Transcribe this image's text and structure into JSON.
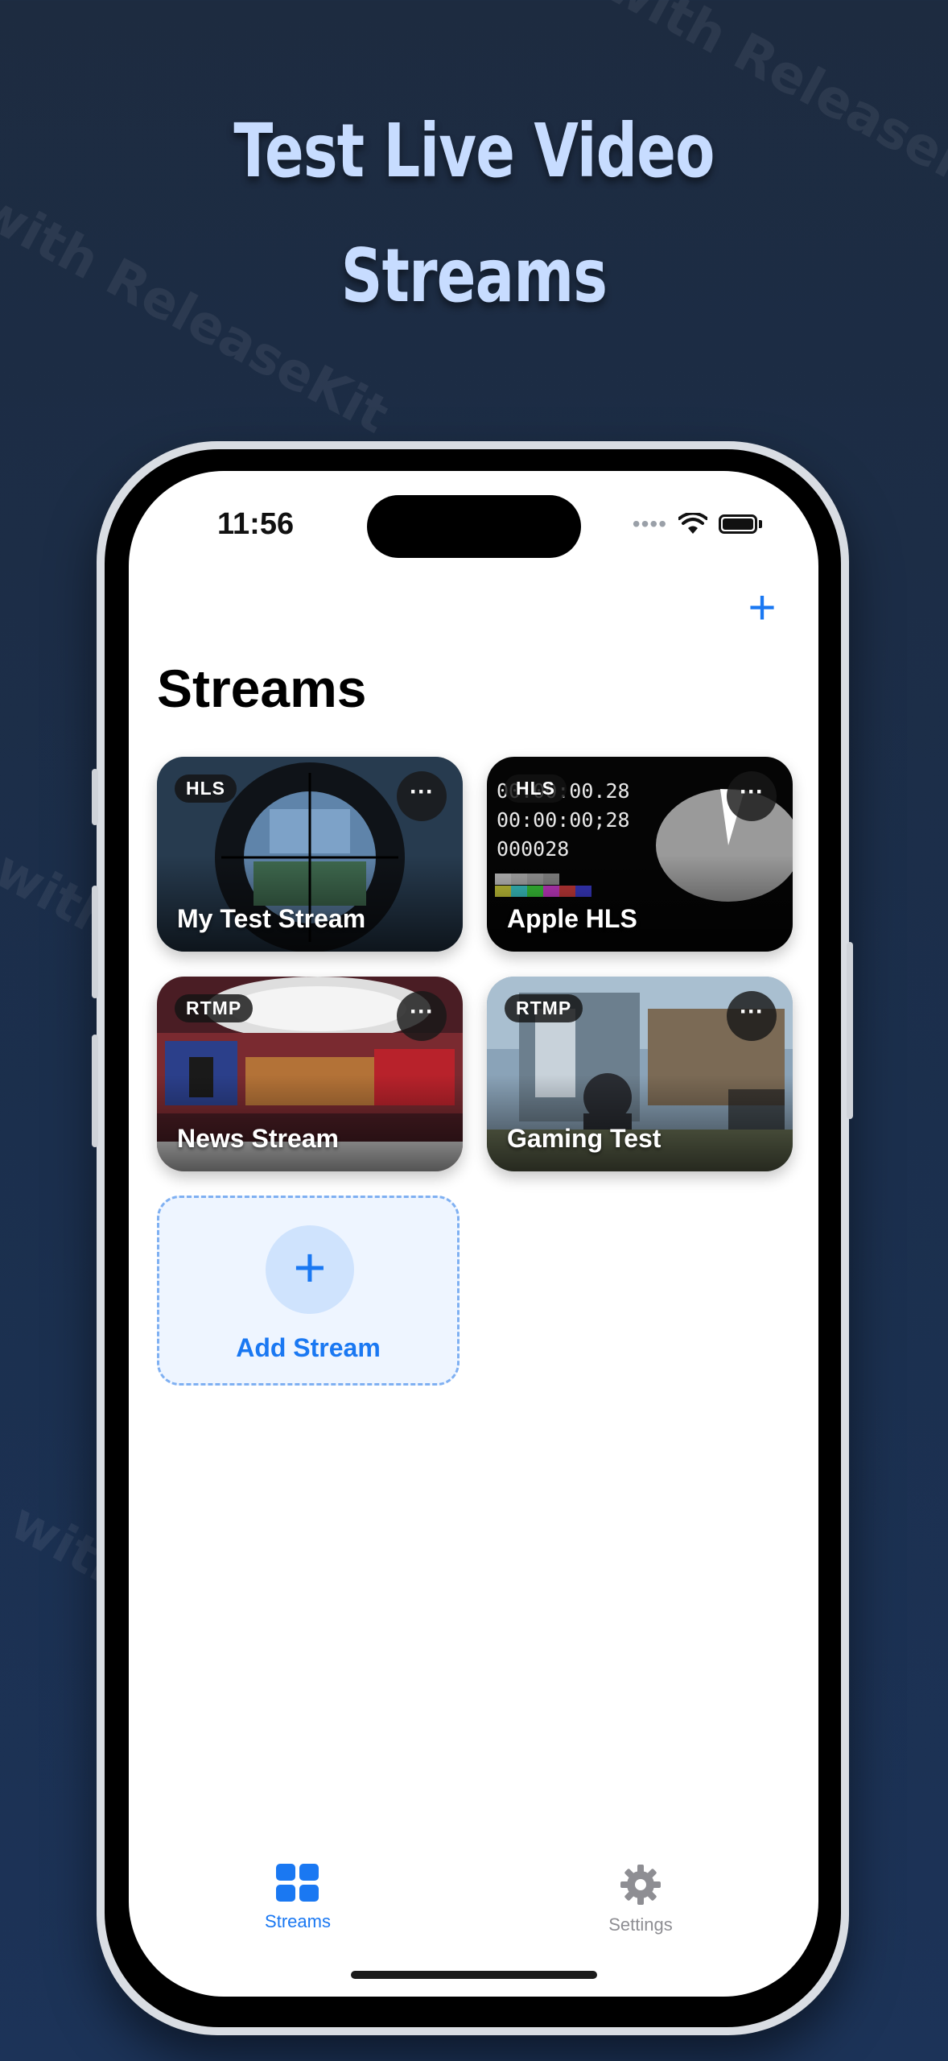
{
  "promo": {
    "headline_line1": "Test Live Video",
    "headline_line2": "Streams",
    "watermark": "Made with ReleaseKit"
  },
  "status_bar": {
    "time": "11:56"
  },
  "nav": {
    "add_icon": "plus-icon",
    "title": "Streams"
  },
  "streams": [
    {
      "title": "My Test Stream",
      "protocol": "HLS",
      "more_icon": "ellipsis-icon"
    },
    {
      "title": "Apple HLS",
      "protocol": "HLS",
      "more_icon": "ellipsis-icon",
      "overlay_lines": [
        "00:00:00.28",
        "00:00:00;28",
        "000028"
      ]
    },
    {
      "title": "News Stream",
      "protocol": "RTMP",
      "more_icon": "ellipsis-icon"
    },
    {
      "title": "Gaming Test",
      "protocol": "RTMP",
      "more_icon": "ellipsis-icon"
    }
  ],
  "add_stream": {
    "label": "Add Stream",
    "icon": "plus-icon"
  },
  "tabbar": {
    "items": [
      {
        "label": "Streams",
        "icon": "grid-icon",
        "active": true
      },
      {
        "label": "Settings",
        "icon": "gear-icon",
        "active": false
      }
    ]
  },
  "colors": {
    "accent": "#1a78f2",
    "background": "#1b2f4d",
    "headline": "#c7dcff"
  }
}
